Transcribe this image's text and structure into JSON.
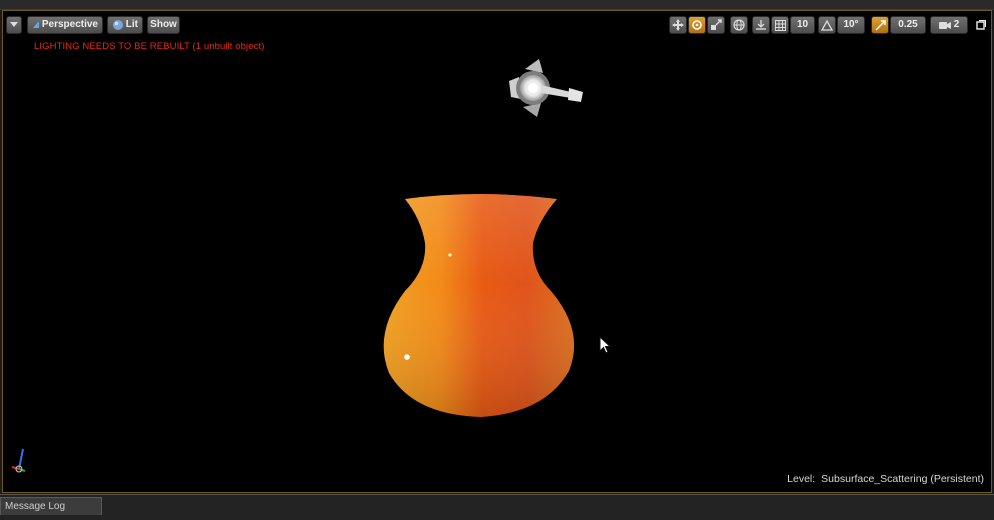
{
  "toolbar": {
    "menu_icon": "chevron-down-icon",
    "perspective_label": "Perspective",
    "lit_label": "Lit",
    "show_label": "Show",
    "grid_snap_value": "10",
    "rotation_snap_value": "10°",
    "scale_snap_value": "0.25",
    "camera_speed_value": "2",
    "accent_color": "#c98b1a"
  },
  "viewport": {
    "warning_text": "LIGHTING NEEDS TO BE REBUILT (1 unbuilt object)",
    "warning_color": "#e02b18",
    "level_label": "Level:",
    "level_value": "Subsurface_Scattering (Persistent)",
    "scene_object": "vase",
    "scene_light_icon": "spotlight-icon"
  },
  "bottom_panel": {
    "tab_label": "Message Log"
  }
}
